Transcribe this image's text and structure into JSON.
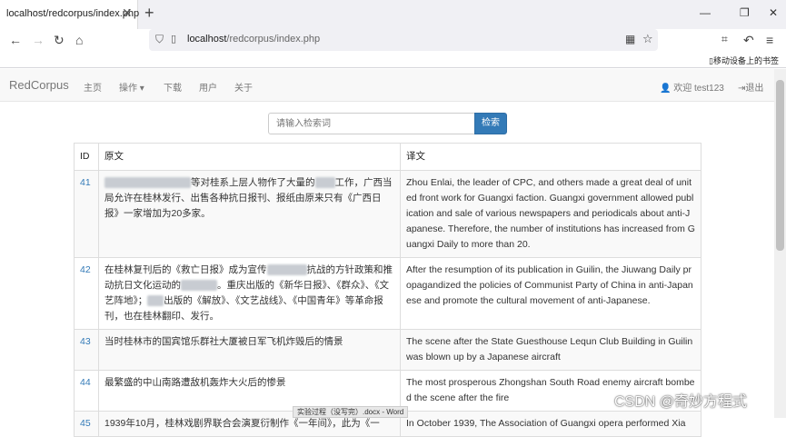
{
  "browser": {
    "tab_title": "localhost/redcorpus/index.php",
    "tab_close": "✕",
    "new_tab": "+",
    "url_host": "localhost",
    "url_path": "/redcorpus/index.php",
    "mobile_bookmarks": "移动设备上的书签"
  },
  "navbar": {
    "brand": "RedCorpus",
    "items": [
      "主页",
      "操作 ▾",
      "下载",
      "用户",
      "关于"
    ],
    "welcome": "欢迎 test123",
    "logout": "退出"
  },
  "search": {
    "placeholder": "请输入检索词",
    "button": "检索"
  },
  "table": {
    "headers": [
      "ID",
      "原文",
      "译文"
    ],
    "rows": [
      {
        "id": "41",
        "orig_pre": "",
        "orig": "等对桂系上层人物作了大量的",
        "orig_mid": "工作，广西当局允许在桂林发行、出售各种抗日报刊、报纸由原来只有《广西日报》一家增加为20多家。",
        "trans": "Zhou Enlai, the leader of CPC, and others made a great deal of united front work for Guangxi faction. Guangxi government allowed publication and sale of various newspapers and periodicals about anti-Japanese. Therefore, the number of institutions has increased from Guangxi Daily to more than 20."
      },
      {
        "id": "42",
        "orig": "在桂林复刊后的《救亡日报》成为宣传",
        "orig_mid": "抗战的方针政策和推动抗日文化运动的",
        "orig_end": "。重庆出版的《新华日报》、《群众》、《文艺阵地》；",
        "orig_tail": "出版的《解放》、《文艺战线》、《中国青年》等革命报刊，也在桂林翻印、发行。",
        "trans": "After the resumption of its publication in Guilin, the Jiuwang Daily propagandized the policies of Communist Party of China in anti-Japanese and promote the cultural movement of anti-Japanese."
      },
      {
        "id": "43",
        "orig": "当时桂林市的国宾馆乐群社大厦被日军飞机炸毁后的情景",
        "trans": "The scene after the State Guesthouse Lequn Club Building in Guilin was blown up by a Japanese aircraft"
      },
      {
        "id": "44",
        "orig": "最繁盛的中山南路遭敌机轰炸大火后的惨景",
        "trans": "The most prosperous Zhongshan South Road enemy aircraft bombed the scene after the fire"
      },
      {
        "id": "45",
        "orig": "1939年10月，桂林戏剧界联合会演夏衍制作《一年间》，此为《一",
        "trans": "In October 1939, The Association of Guangxi opera performed Xia"
      }
    ]
  },
  "statusbar": {
    "text": "实验过程（没写完）.docx - Word"
  },
  "watermark": {
    "text": "CSDN @奇妙方程式"
  }
}
